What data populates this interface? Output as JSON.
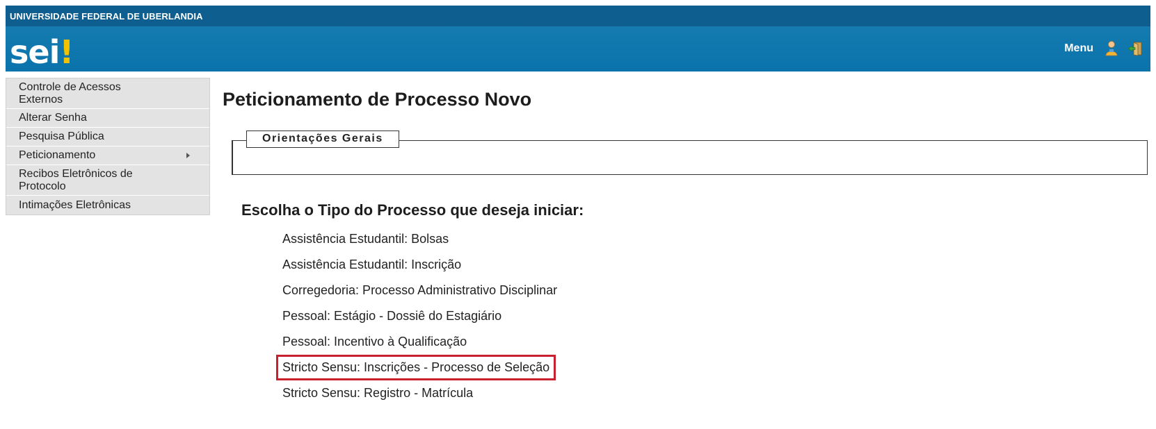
{
  "header": {
    "institution": "UNIVERSIDADE FEDERAL DE UBERLANDIA",
    "logo_text": "sei",
    "logo_bang": "!",
    "menu_label": "Menu",
    "icons": [
      "user-icon",
      "exit-icon"
    ],
    "colors": {
      "bar": "#0a73ab",
      "topbar": "#0e5f8f",
      "accent": "#f2c200"
    }
  },
  "sidebar": {
    "items": [
      {
        "label": "Controle de Acessos Externos"
      },
      {
        "label": "Alterar Senha"
      },
      {
        "label": "Pesquisa Pública"
      },
      {
        "label": "Peticionamento",
        "has_submenu": true
      },
      {
        "label": "Recibos Eletrônicos de Protocolo"
      },
      {
        "label": "Intimações Eletrônicas"
      }
    ]
  },
  "main": {
    "title": "Peticionamento de Processo Novo",
    "orientations_legend": "Orientações Gerais",
    "choose_title": "Escolha o Tipo do Processo que deseja iniciar:",
    "process_types": [
      "Assistência Estudantil: Bolsas",
      "Assistência Estudantil: Inscrição",
      "Corregedoria: Processo Administrativo Disciplinar",
      "Pessoal: Estágio - Dossiê do Estagiário",
      "Pessoal: Incentivo à Qualificação",
      "Stricto Sensu: Inscrições - Processo de Seleção",
      "Stricto Sensu: Registro - Matrícula"
    ],
    "highlighted_index": 5,
    "highlight_color": "#c8202f"
  }
}
